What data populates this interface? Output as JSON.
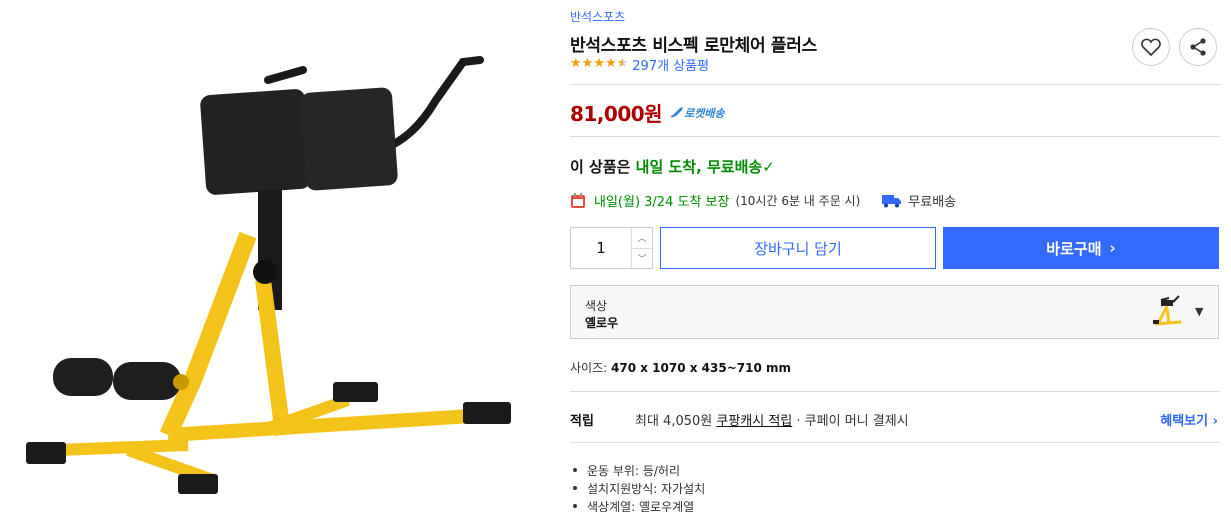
{
  "product": {
    "brand": "반석스포츠",
    "title": "반석스포츠 비스펙 로만체어 플러스",
    "rating_value": 4.5,
    "review_count": "297개 상품평"
  },
  "price": {
    "amount": "81,000원",
    "rocket_label": "로켓배송"
  },
  "delivery": {
    "head_prefix": "이 상품은 ",
    "head_highlight": "내일 도착, 무료배송",
    "head_check": "✓",
    "date_text": "내일(월) 3/24 도착 보장",
    "cutoff_text": "(10시간 6분 내 주문 시)",
    "free_shipping": "무료배송"
  },
  "purchase": {
    "quantity": "1",
    "cart_label": "장바구니 담기",
    "buy_label": "바로구매",
    "buy_arrow": "›"
  },
  "option": {
    "label": "색상",
    "value": "옐로우",
    "arrow": "▼"
  },
  "size": {
    "label": "사이즈:",
    "value": "470 x 1070 x 435~710 mm"
  },
  "points": {
    "label": "적립",
    "prefix": "최대 4,050원 ",
    "cash_link": "쿠팡캐시 적립",
    "suffix": " · 쿠페이 머니 결제시",
    "benefit_link": "혜택보기 ›"
  },
  "attributes": [
    "운동 부위: 등/허리",
    "설치지원방식: 자가설치",
    "색상계열: 옐로우계열"
  ],
  "colors": {
    "accent_blue": "#346aff",
    "price_red": "#ae0000",
    "delivery_green": "#008c00",
    "star_orange": "#f3a00e",
    "frame_yellow": "#f3c319"
  },
  "icons": [
    "heart-icon",
    "share-icon",
    "rocket-icon",
    "calendar-icon",
    "truck-icon",
    "chevron-down-icon"
  ]
}
